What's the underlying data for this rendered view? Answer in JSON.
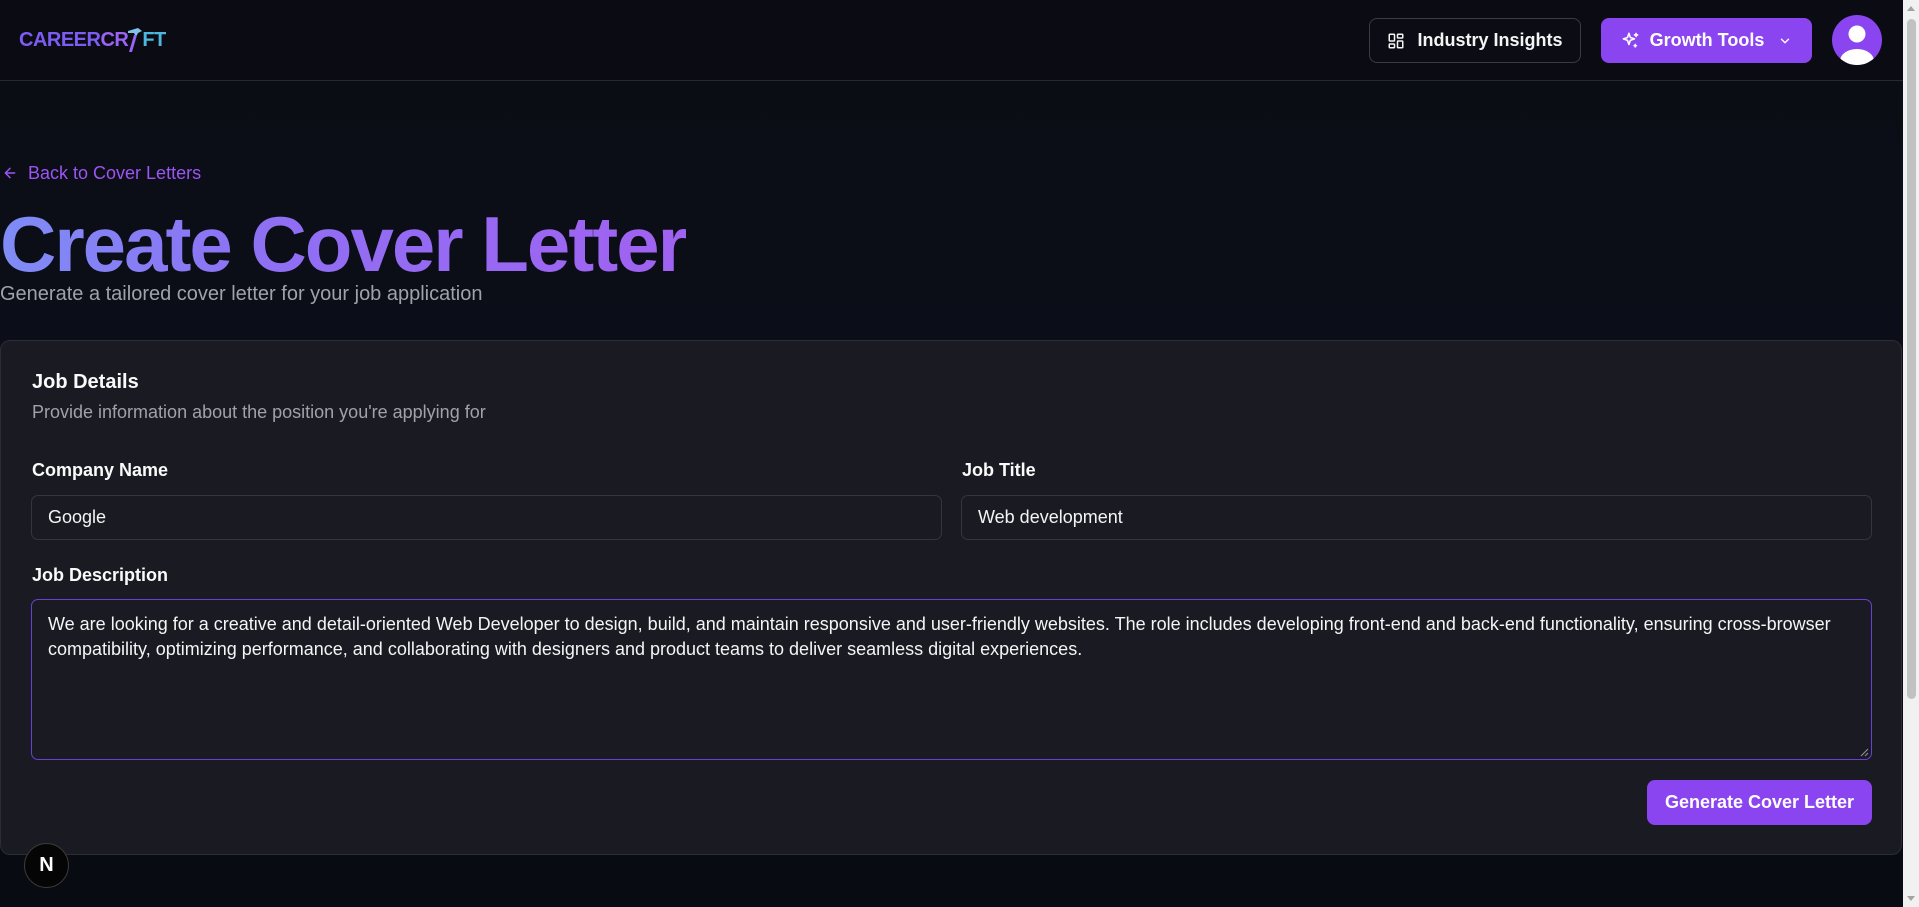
{
  "header": {
    "logo": {
      "part1": "CAREER",
      "part2": "CR",
      "part3": "FT"
    },
    "insights_label": "Industry Insights",
    "growth_label": "Growth Tools"
  },
  "back_link": "Back to Cover Letters",
  "page": {
    "title": "Create Cover Letter",
    "subtitle": "Generate a tailored cover letter for your job application"
  },
  "card": {
    "title": "Job Details",
    "description": "Provide information about the position you're applying for",
    "company_label": "Company Name",
    "company_value": "Google",
    "job_title_label": "Job Title",
    "job_title_value": "Web development",
    "job_description_label": "Job Description",
    "job_description_value": "We are looking for a creative and detail-oriented Web Developer to design, build, and maintain responsive and user-friendly websites. The role includes developing front-end and back-end functionality, ensuring cross-browser compatibility, optimizing performance, and collaborating with designers and product teams to deliver seamless digital experiences.",
    "generate_label": "Generate Cover Letter"
  },
  "next_badge": "N",
  "colors": {
    "accent": "#8b45f0",
    "background": "#0a0b11",
    "card": "#1a1b22",
    "link": "#9b55f3"
  },
  "icons": {
    "insights": "layout-dashboard-icon",
    "growth": "sparkles-icon",
    "dropdown": "chevron-down-icon",
    "back": "arrow-left-icon",
    "avatar": "user-icon"
  }
}
